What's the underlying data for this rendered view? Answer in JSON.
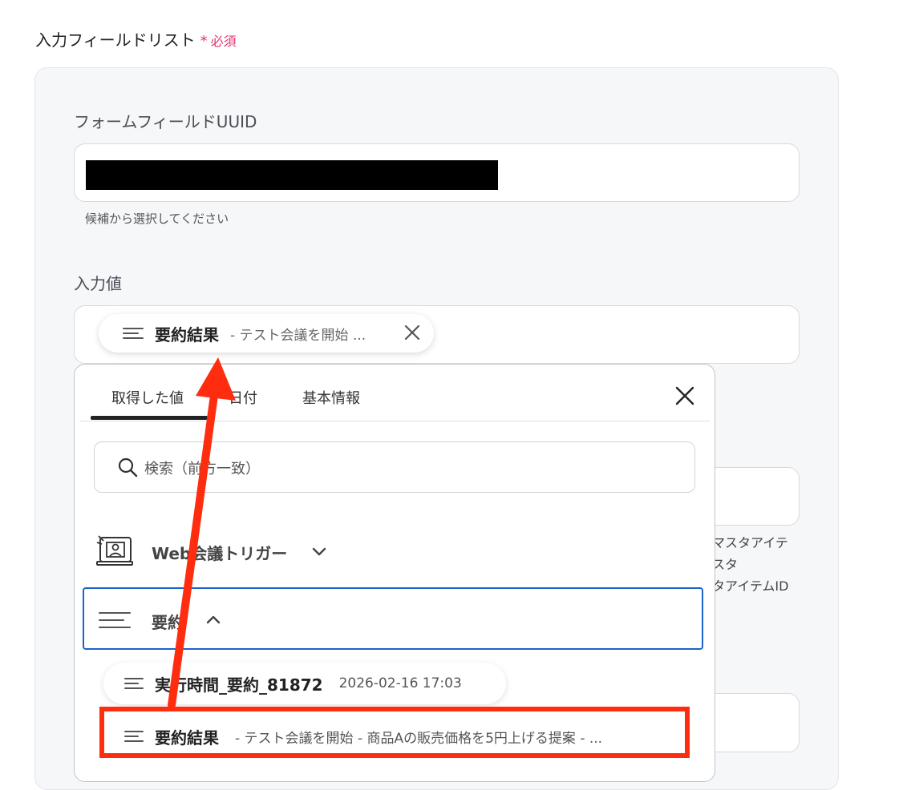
{
  "section": {
    "title": "入力フィールドリスト",
    "required_mark": "*",
    "required_label": "必須"
  },
  "form_uuid": {
    "label": "フォームフィールドUUID",
    "hint": "候補から選択してください"
  },
  "input_value": {
    "label": "入力値",
    "chip": {
      "title": "要約結果",
      "subtitle": "- テスト会議を開始 ..."
    }
  },
  "side_texts": [
    "マスタアイテ",
    "スタ",
    "タアイテムID"
  ],
  "dropdown": {
    "tabs": [
      {
        "label": "取得した値"
      },
      {
        "label": "日付"
      },
      {
        "label": "基本情報"
      }
    ],
    "search_placeholder": "検索（前方一致）",
    "groups": [
      {
        "label": "Web会議トリガー"
      },
      {
        "label": "要約"
      }
    ],
    "items": [
      {
        "title": "実行時間_要約_81872",
        "subtitle": "2026-02-16 17:03"
      },
      {
        "title": "要約結果",
        "subtitle": "- テスト会議を開始 - 商品Aの販売価格を5円上げる提案 - ..."
      }
    ]
  },
  "colors": {
    "accent": "#1b63c9",
    "required": "#e2336b",
    "annotation": "#ff2d10"
  }
}
